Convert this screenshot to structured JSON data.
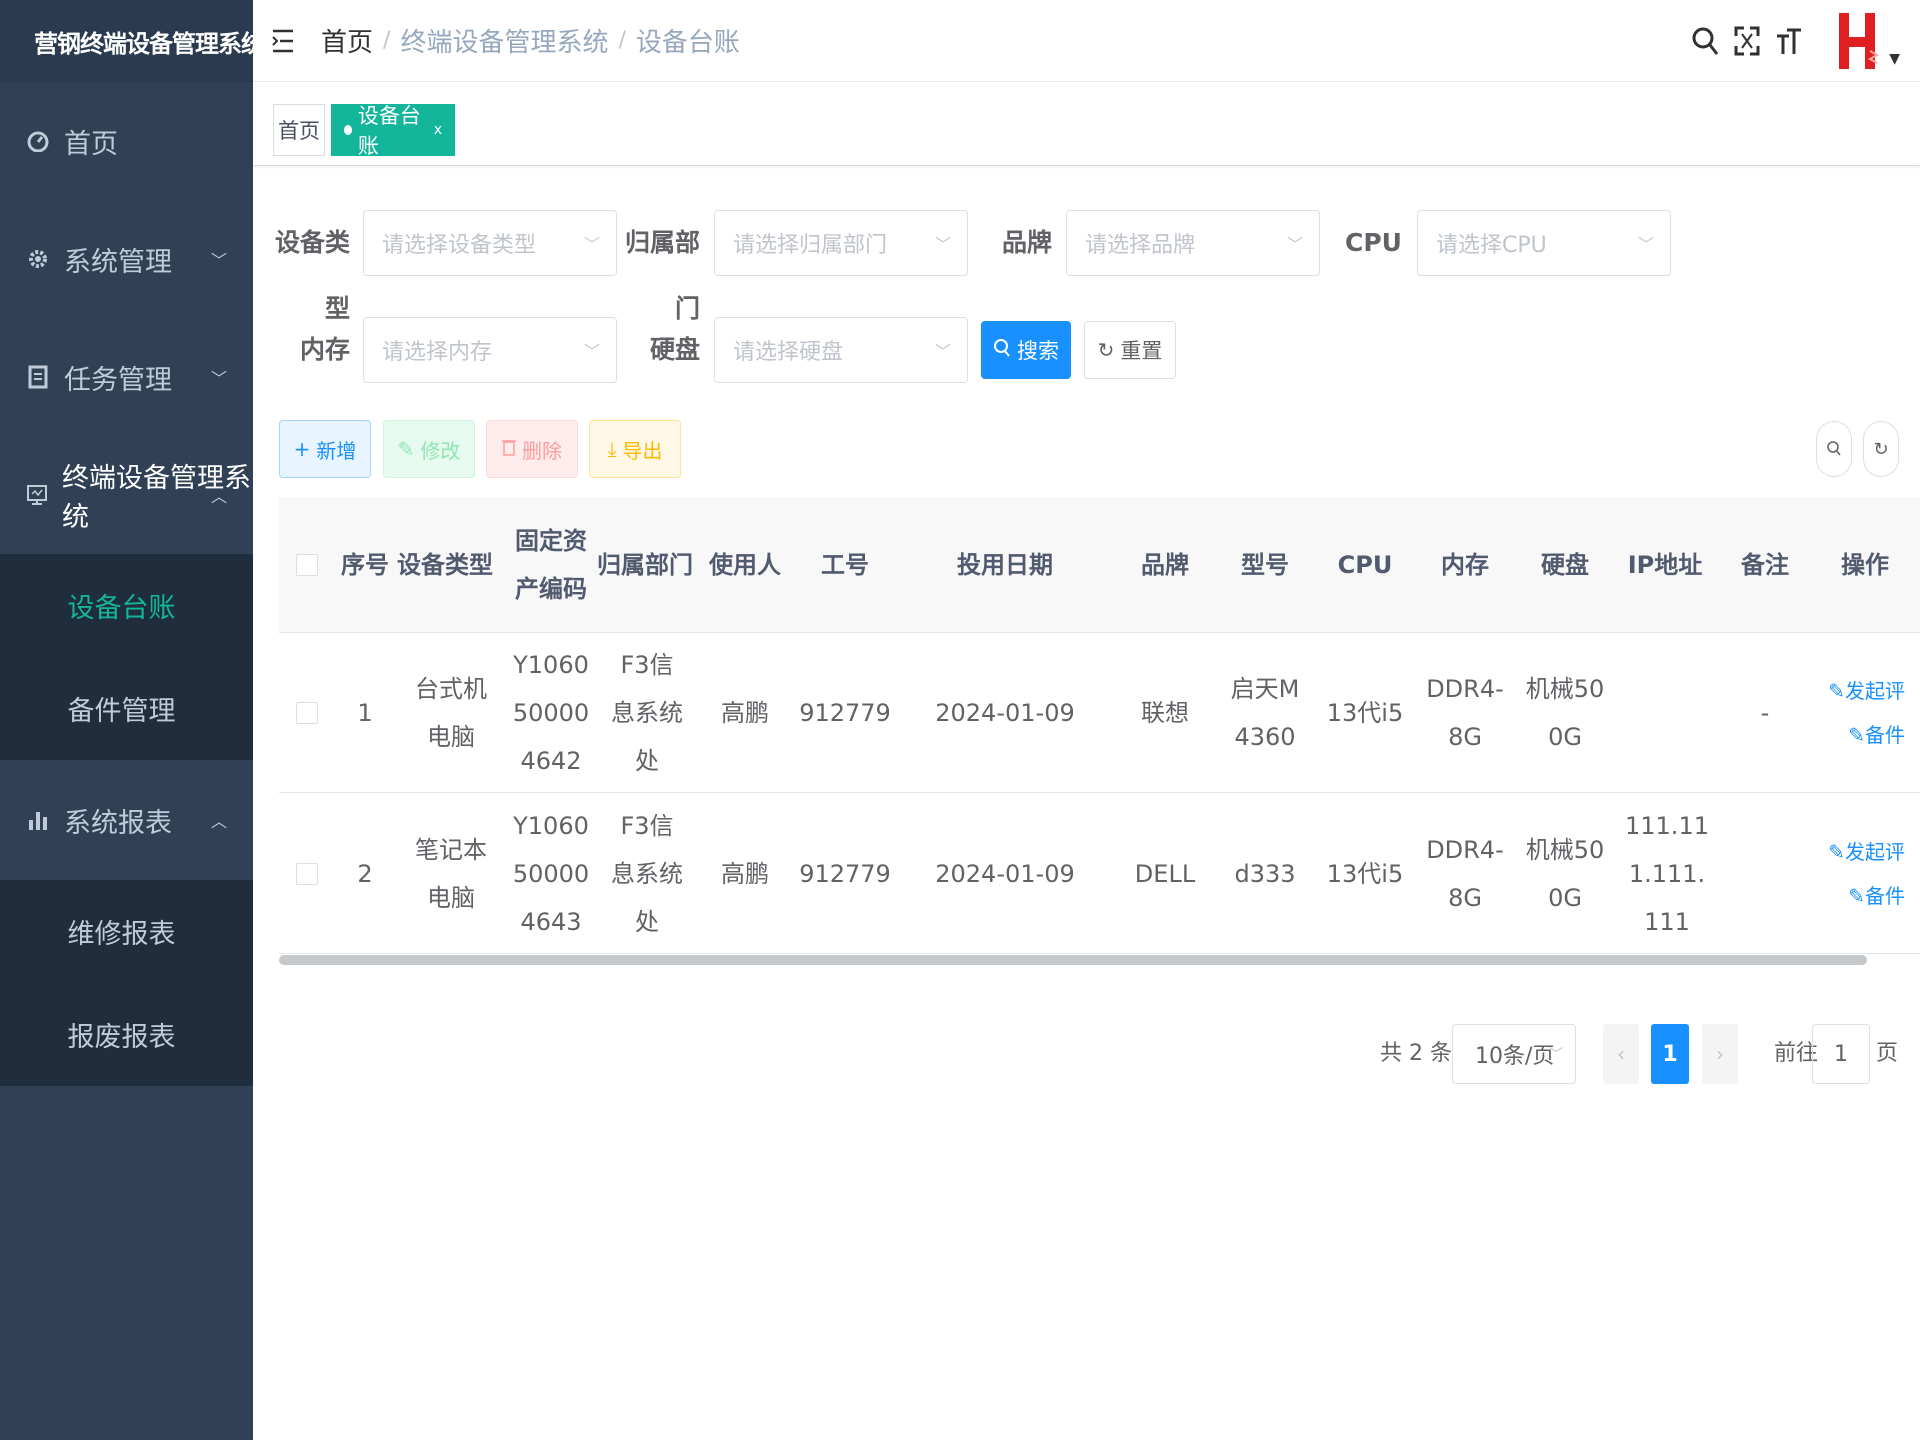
{
  "app": {
    "title": "营钢终端设备管理系统",
    "brand_color": "#e02020",
    "accent": "#13b59b"
  },
  "sidebar": {
    "items": [
      {
        "label": "首页",
        "icon": "dashboard-icon"
      },
      {
        "label": "系统管理",
        "icon": "gear-icon"
      },
      {
        "label": "任务管理",
        "icon": "clipboard-icon"
      },
      {
        "label": "终端设备管理系统",
        "icon": "monitor-icon"
      }
    ],
    "terminal_sub": [
      "设备台账",
      "备件管理"
    ],
    "report": {
      "label": "系统报表",
      "icon": "bar-chart-icon"
    },
    "report_sub": [
      "维修报表",
      "报废报表"
    ]
  },
  "breadcrumb": [
    "首页",
    "终端设备管理系统",
    "设备台账"
  ],
  "tags": {
    "home": "首页",
    "active": "设备台账",
    "close": "x"
  },
  "filters": {
    "device_type": {
      "label": "设备类型",
      "placeholder": "请选择设备类型"
    },
    "dept": {
      "label": "归属部门",
      "placeholder": "请选择归属部门"
    },
    "brand": {
      "label": "品牌",
      "placeholder": "请选择品牌"
    },
    "cpu": {
      "label": "CPU",
      "placeholder": "请选择CPU"
    },
    "memory": {
      "label": "内存",
      "placeholder": "请选择内存"
    },
    "disk": {
      "label": "硬盘",
      "placeholder": "请选择硬盘"
    },
    "search_label": "搜索",
    "reset_label": "重置"
  },
  "toolbar": {
    "add": "新增",
    "edit": "修改",
    "delete": "删除",
    "export": "导出"
  },
  "table": {
    "headers": {
      "index": "序号",
      "type": "设备类型",
      "asset": "固定资产编码",
      "dept": "归属部门",
      "user": "使用人",
      "emp": "工号",
      "date": "投用日期",
      "brand": "品牌",
      "model": "型号",
      "cpu": "CPU",
      "mem": "内存",
      "disk": "硬盘",
      "ip": "IP地址",
      "note": "备注",
      "ops": "操作"
    },
    "rows": [
      {
        "index": "1",
        "type": "台式机电脑",
        "asset": "Y1060500004642",
        "dept": "F3信息系统处",
        "user": "高鹏",
        "emp": "912779",
        "date": "2024-01-09",
        "brand": "联想",
        "model": "启天M4360",
        "cpu": "13代i5",
        "mem": "DDR4-8G",
        "disk": "机械500G",
        "ip": "",
        "note": "-",
        "op1": "发起评",
        "op2": "备件"
      },
      {
        "index": "2",
        "type": "笔记本电脑",
        "asset": "Y1060500004643",
        "dept": "F3信息系统处",
        "user": "高鹏",
        "emp": "912779",
        "date": "2024-01-09",
        "brand": "DELL",
        "model": "d333",
        "cpu": "13代i5",
        "mem": "DDR4-8G",
        "disk": "机械500G",
        "ip": "111.111.111.111",
        "note": "",
        "op1": "发起评",
        "op2": "备件"
      }
    ]
  },
  "pagination": {
    "total": "共 2 条",
    "page_size": "10条/页",
    "current": "1",
    "goto_prefix": "前往",
    "goto_value": "1",
    "goto_suffix": "页"
  }
}
